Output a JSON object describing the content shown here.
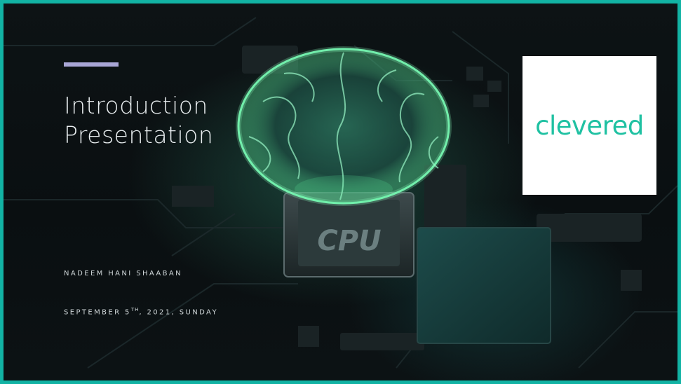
{
  "slide": {
    "title_line1": "Introduction",
    "title_line2": "Presentation",
    "author": "NADEEM HANI SHAABAN",
    "date_prefix": "SEPTEMBER 5",
    "date_superscript": "TH",
    "date_suffix": ", 2021, SUNDAY",
    "chip_label": "CPU"
  },
  "logo": {
    "text": "clevered"
  },
  "colors": {
    "border": "#12b3a4",
    "accent_line": "#a9a6d6",
    "logo_text": "#1fc1a2",
    "brain_glow": "#5ff2a0"
  },
  "icons": {
    "hero_image": "brain-on-cpu-illustration"
  }
}
